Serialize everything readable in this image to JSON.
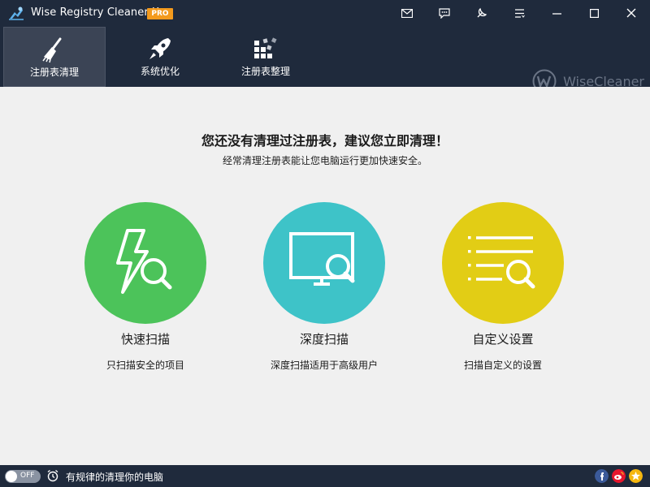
{
  "window": {
    "title": "Wise Registry Cleaner X",
    "badge": "PRO"
  },
  "titlebar_icons": [
    "mail-icon",
    "feedback-icon",
    "skin-icon",
    "menu-icon",
    "minimize-icon",
    "maximize-icon",
    "close-icon"
  ],
  "nav": {
    "tabs": [
      {
        "label": "注册表清理",
        "icon": "broom-icon",
        "active": true
      },
      {
        "label": "系统优化",
        "icon": "rocket-icon",
        "active": false
      },
      {
        "label": "注册表整理",
        "icon": "defrag-blocks-icon",
        "active": false
      }
    ],
    "brand": "WiseCleaner"
  },
  "main": {
    "headline": "您还没有清理过注册表，建议您立即清理！",
    "subline": "经常清理注册表能让您电脑运行更加快速安全。",
    "scans": [
      {
        "title": "快速扫描",
        "desc": "只扫描安全的项目",
        "color": "#4cc35a",
        "icon": "lightning-search-icon"
      },
      {
        "title": "深度扫描",
        "desc": "深度扫描适用于高级用户",
        "color": "#3ec3c8",
        "icon": "monitor-search-icon"
      },
      {
        "title": "自定义设置",
        "desc": "扫描自定义的设置",
        "color": "#e2cd15",
        "icon": "list-search-icon"
      }
    ]
  },
  "status": {
    "toggle_label": "OFF",
    "schedule_text": "有规律的清理你的电脑"
  },
  "colors": {
    "dark_bg": "#1f2a3c",
    "active_tab": "#3b4455",
    "pro_badge": "#f39a1d",
    "content_bg": "#f0f0f0"
  }
}
